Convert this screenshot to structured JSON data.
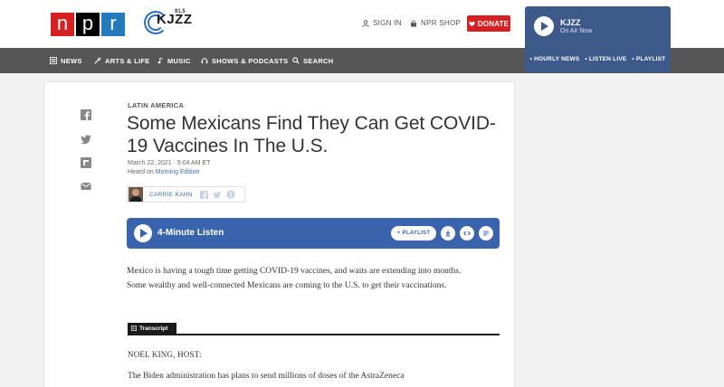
{
  "header": {
    "npr_logo": [
      "n",
      "p",
      "r"
    ],
    "station_logo": {
      "name": "KJZZ",
      "freq": "91.5"
    },
    "sign_in": "SIGN IN",
    "shop": "NPR SHOP",
    "donate": "DONATE"
  },
  "player": {
    "station": "KJZZ",
    "status": "On Air Now",
    "links": [
      "• HOURLY NEWS",
      "• LISTEN LIVE",
      "• PLAYLIST"
    ]
  },
  "nav": {
    "items": [
      {
        "label": "NEWS",
        "icon": "news-icon"
      },
      {
        "label": "ARTS & LIFE",
        "icon": "arts-icon"
      },
      {
        "label": "MUSIC",
        "icon": "music-icon"
      },
      {
        "label": "SHOWS & PODCASTS",
        "icon": "headphones-icon"
      },
      {
        "label": "SEARCH",
        "icon": "search-icon"
      }
    ]
  },
  "share": {
    "icons": [
      "facebook-icon",
      "twitter-icon",
      "flipboard-icon",
      "email-icon"
    ]
  },
  "article": {
    "kicker": "LATIN AMERICA",
    "headline": "Some Mexicans Find They Can Get COVID-19 Vaccines In The U.S.",
    "date": "March 22, 2021 · 5:04 AM ET",
    "heard_on_prefix": "Heard on ",
    "heard_on_show": "Morning Edition",
    "author": "CARRIE KAHN",
    "teaser": "Mexico is having a tough time getting COVID-19 vaccines, and waits are extending into months. Some wealthy and well-connected Mexicans are coming to the U.S. to get their vaccinations."
  },
  "listen": {
    "title": "4-Minute Listen",
    "playlist": "+ PLAYLIST"
  },
  "transcript": {
    "tab": "Transcript",
    "speaker": "NOEL KING, HOST:",
    "first_line": "The Biden administration has plans to send millions of doses of the AstraZeneca"
  },
  "colors": {
    "npr_red": "#d62021",
    "npr_blue": "#237bbd",
    "nav_bg": "#565656",
    "player_bg": "#3d5a8a",
    "listen_bg": "#3a63ad",
    "link_blue": "#3f6cb2"
  }
}
